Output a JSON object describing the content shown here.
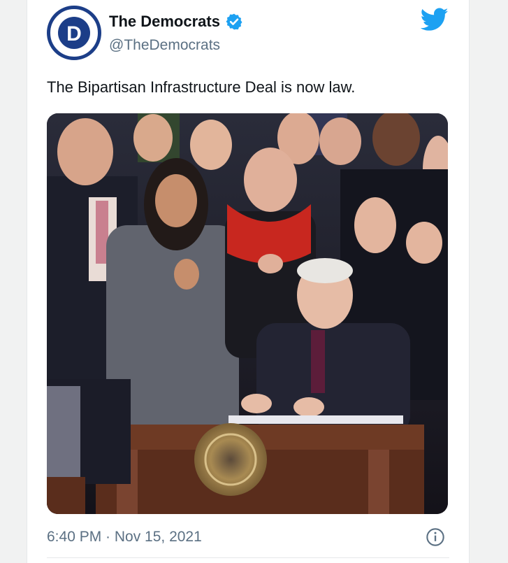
{
  "tweet": {
    "display_name": "The Democrats",
    "handle": "@TheDemocrats",
    "text": "The Bipartisan Infrastructure Deal is now law.",
    "timestamp": "6:40 PM · Nov 15, 2021",
    "avatar_letter": "D",
    "verified": true
  },
  "icons": {
    "brand": "twitter-bird-icon",
    "verified": "verified-badge-icon",
    "info": "info-icon"
  },
  "colors": {
    "brand_blue": "#1da1f2",
    "party_navy": "#1c3e88",
    "text_primary": "#0f1419",
    "text_secondary": "#5b7083"
  }
}
